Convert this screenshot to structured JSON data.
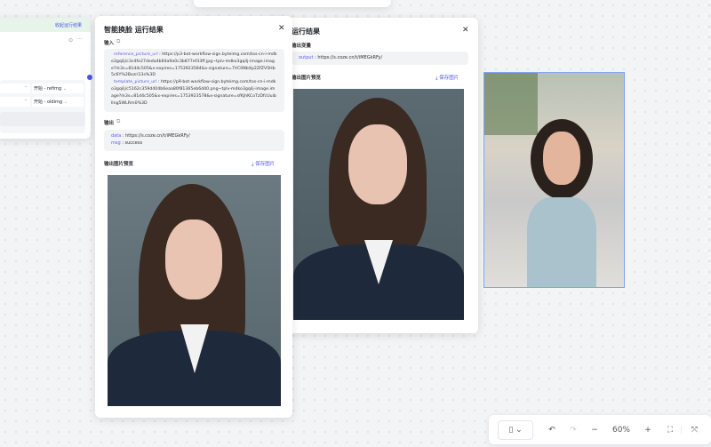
{
  "left_node": {
    "collapse_label": "收起运行结果",
    "rows": [
      {
        "value": "开始 - refimg"
      },
      {
        "value": "开始 - oldimg"
      }
    ]
  },
  "panel_back": {
    "title": "运行结果",
    "output_label": "输出变量",
    "output": {
      "key": "output",
      "value": "https://s.coze.cn/t/iMEGkRFy/"
    },
    "preview_label": "输出图片预览",
    "save_label": "保存图片"
  },
  "panel_front": {
    "title": "智能换脸 运行结果",
    "input_label": "输入",
    "inputs": [
      {
        "key": "reference_picture_url",
        "value": "https://p3-bot-workflow-sign.byteimg.com/tos-cn-i-mdko3gqilj/c3c4fe27deda4b64a9a0c3b877ef33ff.jpg~tplv-mdko3gqilj-image.image?rk3s=81d4c505&x-expires=1753923584&x-signature=7VC0NbXp2ZfZV5Hb5c6Y%2Bxzri13s%3D"
      },
      {
        "key": "template_picture_url",
        "value": "https://p9-bot-workflow-sign.byteimg.com/tos-cn-i-mdko3gqilj/c5162c359d404b6eaa80f81365eb6d40.png~tplv-mdko3gqilj-image.image?rk3s=81d4c505&x-expires=1753923578&x-signature=sfKjhKCoTzDfcUuibllng5WLRm0%3D"
      }
    ],
    "output_label": "输出",
    "outputs": [
      {
        "key": "data",
        "value": "https://s.coze.cn/t/iMEGkRFy/"
      },
      {
        "key": "msg",
        "value": "success"
      }
    ],
    "preview_label": "输出图片预览",
    "save_label": "保存图片"
  },
  "toolbar": {
    "zoom": "60%"
  },
  "colors": {
    "accent": "#4d53e8",
    "selection": "#7ea6f2"
  }
}
